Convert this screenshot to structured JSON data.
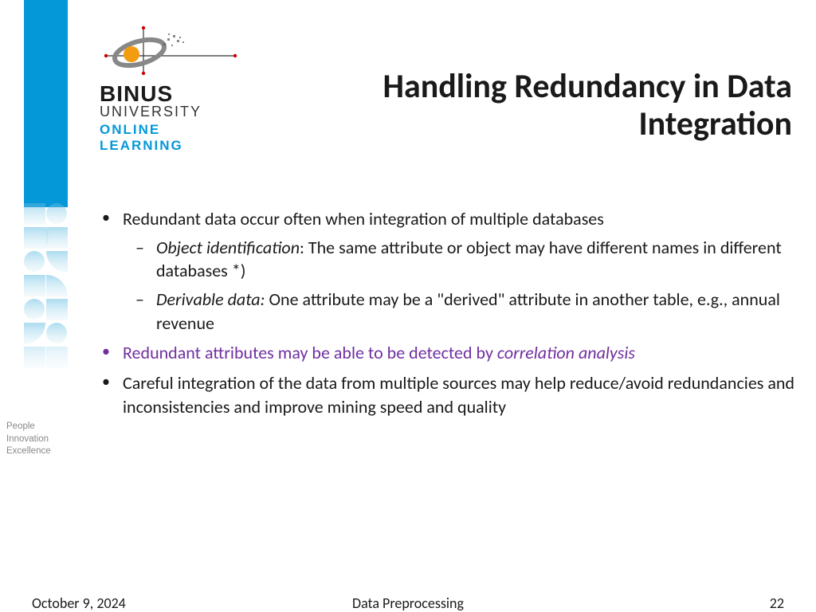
{
  "sidebar": {
    "tagline": [
      "People",
      "Innovation",
      "Excellence"
    ]
  },
  "logo": {
    "line1": "BINUS",
    "line2": "UNIVERSITY",
    "line3": "ONLINE",
    "line4": "LEARNING"
  },
  "title": "Handling Redundancy in Data Integration",
  "bullets": {
    "b1": "Redundant data occur often when integration of multiple databases",
    "b1a_em": "Object identification",
    "b1a_rest": ":  The same attribute or object may have different names in different databases *)",
    "b1b_em": "Derivable data:",
    "b1b_rest": " One attribute may be a \"derived\" attribute in another table, e.g., annual revenue",
    "b2_pre": "Redundant attributes may be able to be detected by ",
    "b2_em": "correlation analysis",
    "b3": "Careful integration of the data from multiple sources may help reduce/avoid redundancies and inconsistencies and improve mining speed and quality"
  },
  "footer": {
    "date": "October 9, 2024",
    "topic": "Data Preprocessing",
    "page": "22"
  }
}
